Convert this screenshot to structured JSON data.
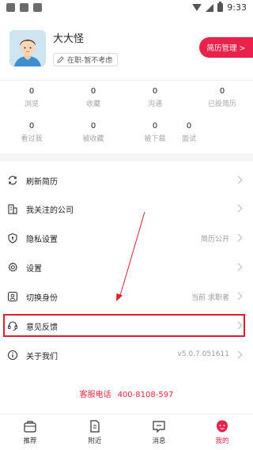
{
  "status_bar": {
    "time": "9:33"
  },
  "profile": {
    "name": "大大怪",
    "job_status": "在职-暂不考虑",
    "resume_button": "简历管理 >"
  },
  "stats": [
    {
      "value": "0",
      "label": "浏览"
    },
    {
      "value": "0",
      "label": "收藏"
    },
    {
      "value": "0",
      "label": "沟通"
    },
    {
      "value": "0",
      "label": "已投简历"
    },
    {
      "value": "0",
      "label": "看过我"
    },
    {
      "value": "0",
      "label": "被收藏"
    },
    {
      "value": "0",
      "label": "被下载"
    },
    {
      "value": "0",
      "label": "面试"
    }
  ],
  "menu": [
    {
      "icon": "refresh-icon",
      "label": "刷新简历",
      "value": ""
    },
    {
      "icon": "building-icon",
      "label": "我关注的公司",
      "value": ""
    },
    {
      "icon": "shield-icon",
      "label": "隐私设置",
      "value": "简历公开"
    },
    {
      "icon": "gear-icon",
      "label": "设置",
      "value": ""
    },
    {
      "icon": "switch-identity-icon",
      "label": "切换身份",
      "value": "当前 求职者"
    },
    {
      "icon": "headset-icon",
      "label": "意见反馈",
      "value": ""
    },
    {
      "icon": "info-icon",
      "label": "关于我们",
      "value": "v5.0.7.051611"
    }
  ],
  "hotline": {
    "label": "客服电话",
    "number": "400-8108-597"
  },
  "bottom_nav": [
    {
      "icon": "bag-icon",
      "label": "推荐",
      "active": false
    },
    {
      "icon": "document-icon",
      "label": "附近",
      "active": false
    },
    {
      "icon": "chat-icon",
      "label": "消息",
      "active": false
    },
    {
      "icon": "profile-icon",
      "label": "我的",
      "active": true
    }
  ],
  "colors": {
    "accent": "#e8224a",
    "highlight_box": "#e01e2a",
    "muted_text": "#a6a6a6"
  }
}
